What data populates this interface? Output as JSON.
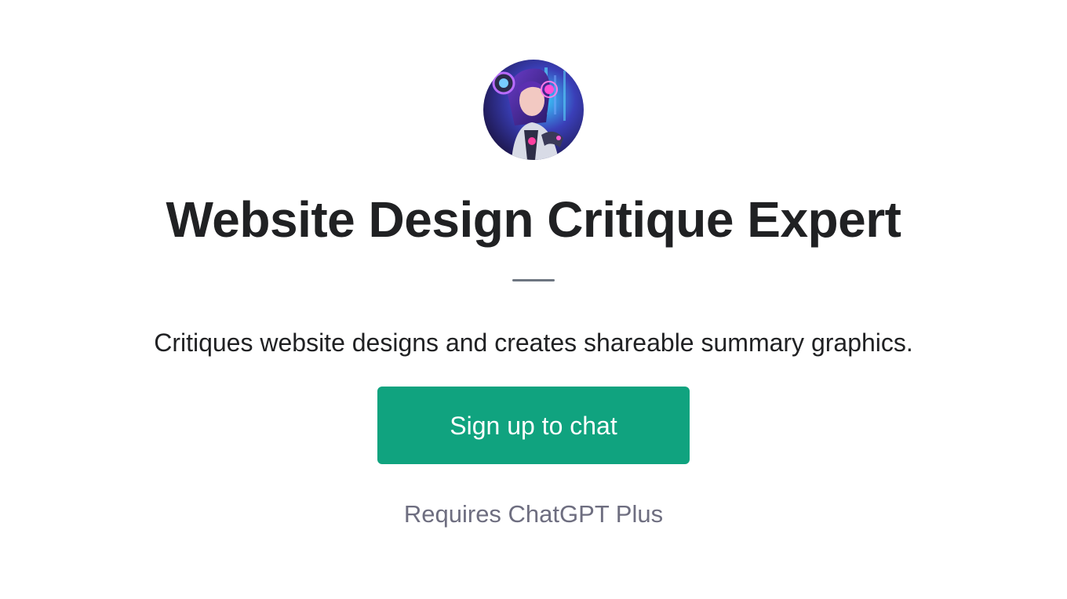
{
  "gpt": {
    "avatar_alt": "",
    "title": "Website Design Critique Expert",
    "description": "Critiques website designs and creates shareable summary graphics."
  },
  "actions": {
    "signup_label": "Sign up to chat"
  },
  "footer": {
    "requirement": "Requires ChatGPT Plus"
  },
  "colors": {
    "accent": "#10a37f",
    "text": "#202123",
    "muted": "#6e6e80"
  }
}
